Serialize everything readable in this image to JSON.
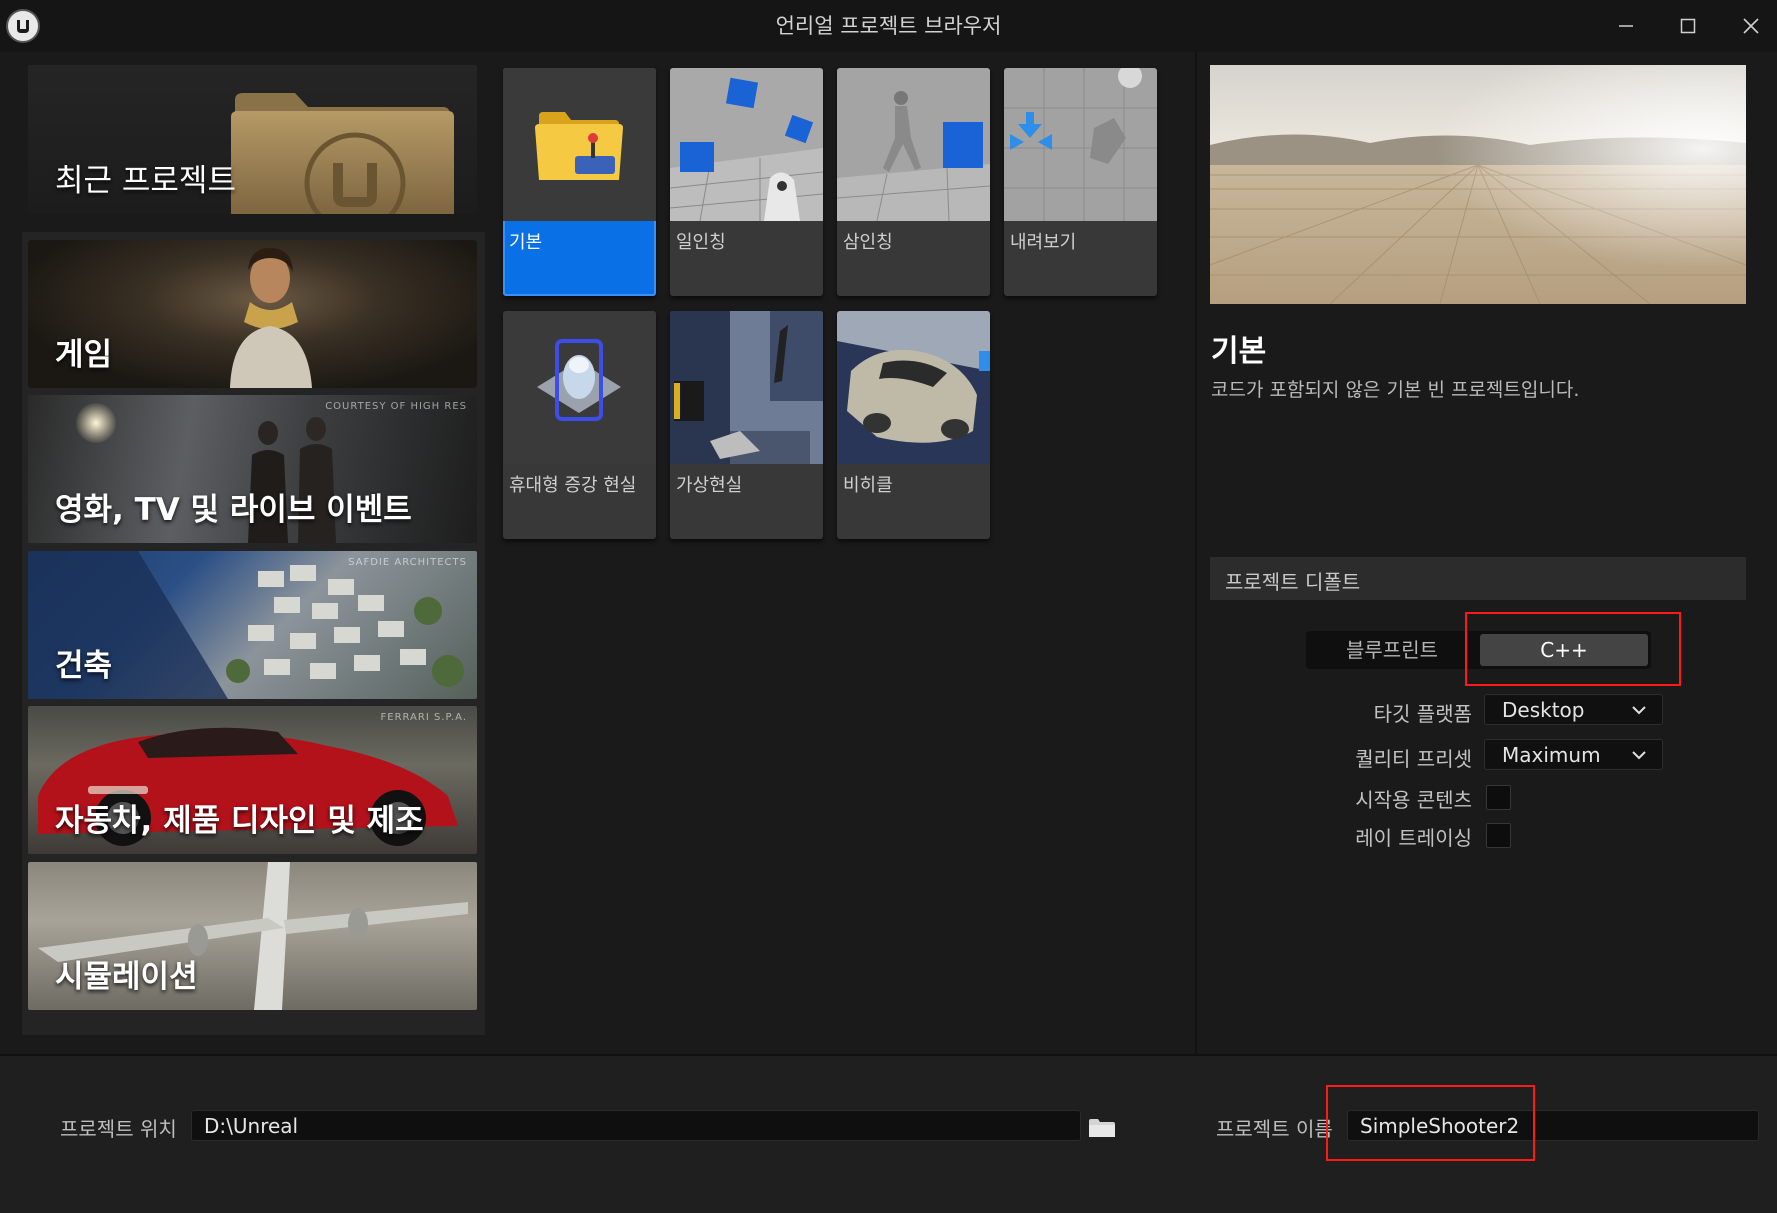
{
  "window": {
    "title": "언리얼 프로젝트 브라우저",
    "logo_icon": "unreal-engine-logo",
    "controls": [
      "minimize-icon",
      "maximize-icon",
      "close-icon"
    ]
  },
  "recent": {
    "label": "최근 프로젝트"
  },
  "categories": [
    {
      "label": "게임",
      "credit": "",
      "selected": true
    },
    {
      "label": "영화, TV 및 라이브 이벤트",
      "credit": "COURTESY OF HIGH RES",
      "selected": false
    },
    {
      "label": "건축",
      "credit": "SAFDIE ARCHITECTS",
      "selected": false
    },
    {
      "label": "자동차, 제품 디자인 및 제조",
      "credit": "FERRARI S.P.A.",
      "selected": false
    },
    {
      "label": "시뮬레이션",
      "credit": "",
      "selected": false
    }
  ],
  "templates": [
    {
      "label": "기본",
      "selected": true
    },
    {
      "label": "일인칭",
      "selected": false
    },
    {
      "label": "삼인칭",
      "selected": false
    },
    {
      "label": "내려보기",
      "selected": false
    },
    {
      "label": "휴대형 증강 현실",
      "selected": false
    },
    {
      "label": "가상현실",
      "selected": false
    },
    {
      "label": "비히클",
      "selected": false
    }
  ],
  "details": {
    "title": "기본",
    "description": "코드가 포함되지 않은 기본 빈 프로젝트입니다."
  },
  "project_defaults": {
    "header": "프로젝트 디폴트",
    "language_options": [
      "블루프린트",
      "C++"
    ],
    "selected_language": "C++",
    "target_platform": {
      "label": "타깃 플랫폼",
      "value": "Desktop"
    },
    "quality_preset": {
      "label": "퀄리티 프리셋",
      "value": "Maximum"
    },
    "starter_content": {
      "label": "시작용 콘텐츠",
      "checked": false
    },
    "raytracing": {
      "label": "레이 트레이싱",
      "checked": false
    }
  },
  "bottom": {
    "location_label": "프로젝트 위치",
    "location_value": "D:\\Unreal",
    "name_label": "프로젝트 이름",
    "name_value": "SimpleShooter2"
  },
  "colors": {
    "accent": "#0a70e6",
    "highlight_box": "#ff1a1a",
    "background": "#1a1a1a"
  }
}
